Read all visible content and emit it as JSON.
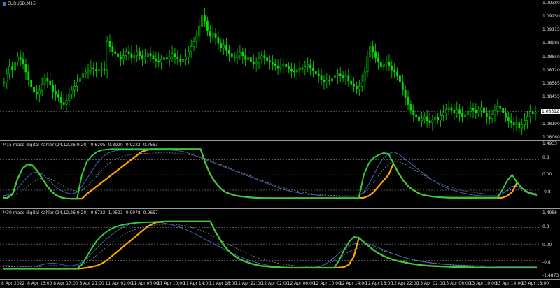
{
  "main_chart": {
    "symbol_label": "EURUSD,M15",
    "price_labels": [
      "1.09380",
      "1.09250",
      "1.09115",
      "1.08985",
      "1.08850",
      "1.08720",
      "1.08585",
      "1.08455",
      "1.08190",
      "1.08060"
    ],
    "current_price": "1.08312",
    "candle_color": "#00e000",
    "price_ylim": [
      1.0806,
      1.0938
    ],
    "closes": [
      1.086,
      1.0868,
      1.0875,
      1.0872,
      1.088,
      1.0885,
      1.0882,
      1.0878,
      1.087,
      1.0862,
      1.0855,
      1.085,
      1.0848,
      1.0852,
      1.0858,
      1.0864,
      1.0861,
      1.0857,
      1.0851,
      1.0848,
      1.0845,
      1.084,
      1.0838,
      1.0842,
      1.0848,
      1.0852,
      1.0856,
      1.086,
      1.0864,
      1.0868,
      1.087,
      1.0872,
      1.0874,
      1.0873,
      1.0871,
      1.0872,
      1.0873,
      1.0872,
      1.09,
      1.0895,
      1.089,
      1.0888,
      1.0885,
      1.0883,
      1.0886,
      1.089,
      1.0888,
      1.0884,
      1.0886,
      1.089,
      1.0886,
      1.0883,
      1.0885,
      1.0888,
      1.0886,
      1.0883,
      1.0881,
      1.088,
      1.0882,
      1.0884,
      1.0883,
      1.0885,
      1.0888,
      1.0885,
      1.0883,
      1.088,
      1.0882,
      1.0885,
      1.089,
      1.0895,
      1.09,
      1.0905,
      1.0915,
      1.0926,
      1.092,
      1.091,
      1.0905,
      1.0908,
      1.0904,
      1.0898,
      1.0894,
      1.0896,
      1.0891,
      1.0888,
      1.0885,
      1.0884,
      1.0887,
      1.0889,
      1.0886,
      1.0882,
      1.0884,
      1.088,
      1.0878,
      1.0879,
      1.0883,
      1.0886,
      1.0884,
      1.0881,
      1.088,
      1.0878,
      1.0876,
      1.0874,
      1.0876,
      1.0878,
      1.0875,
      1.0873,
      1.0871,
      1.087,
      1.0872,
      1.0874,
      1.0873,
      1.0875,
      1.0877,
      1.0874,
      1.0871,
      1.0868,
      1.0866,
      1.0862,
      1.086,
      1.0862,
      1.0861,
      1.0864,
      1.0866,
      1.0868,
      1.0866,
      1.0864,
      1.0866,
      1.0861,
      1.0858,
      1.0856,
      1.0853,
      1.0856,
      1.086,
      1.087,
      1.0885,
      1.0895,
      1.089,
      1.0884,
      1.088,
      1.0875,
      1.0878,
      1.088,
      1.0876,
      1.0872,
      1.087,
      1.0866,
      1.086,
      1.0852,
      1.0845,
      1.0838,
      1.0832,
      1.0828,
      1.0826,
      1.0822,
      1.0824,
      1.0826,
      1.0822,
      1.082,
      1.0823,
      1.0825,
      1.0823,
      1.0827,
      1.083,
      1.0833,
      1.0835,
      1.0832,
      1.083,
      1.0833,
      1.0829,
      1.0826,
      1.0828,
      1.0831,
      1.0834,
      1.0832,
      1.083,
      1.0832,
      1.0835,
      1.083,
      1.0826,
      1.0824,
      1.0828,
      1.0832,
      1.0836,
      1.0834,
      1.083,
      1.0825,
      1.0822,
      1.082,
      1.0818,
      1.082,
      1.0815,
      1.0818,
      1.0822,
      1.0826,
      1.0831,
      1.0829,
      1.0831
    ]
  },
  "indicator1": {
    "label": "M15 macd digital Kahler (14,12,26,9,20) -0.6205 -0.8920 -0.9222 -0.7563",
    "scale_labels": [
      "1.4933",
      "0.8",
      "0.00",
      "-0.8"
    ],
    "series": {
      "green": [
        -1.22,
        -1.2,
        -1.0,
        -0.2,
        0.35,
        0.55,
        0.5,
        0.2,
        -0.2,
        -0.6,
        -0.9,
        -1.1,
        -1.2,
        -1.24,
        -1.25,
        -1.25,
        0.0,
        0.7,
        1.0,
        1.2,
        1.3,
        1.33,
        1.35,
        1.35,
        1.35,
        1.35,
        1.35,
        1.35,
        1.35,
        1.35,
        1.35,
        1.35,
        1.35,
        1.35,
        1.35,
        1.35,
        1.35,
        1.35,
        1.35,
        1.35,
        1.35,
        0.6,
        0.0,
        -0.4,
        -0.7,
        -0.9,
        -1.0,
        -1.08,
        -1.12,
        -1.15,
        -1.18,
        -1.2,
        -1.21,
        -1.22,
        -1.22,
        -1.22,
        -1.22,
        -1.22,
        -1.22,
        -1.22,
        -1.22,
        -1.22,
        -1.22,
        -1.22,
        -1.22,
        -1.22,
        -1.22,
        -1.22,
        -1.22,
        -1.22,
        -1.22,
        -1.22,
        -1.22,
        0.0,
        0.6,
        0.9,
        1.05,
        1.15,
        1.1,
        0.6,
        0.1,
        -0.3,
        -0.6,
        -0.8,
        -0.95,
        -1.05,
        -1.1,
        -1.14,
        -1.16,
        -1.18,
        -1.19,
        -1.2,
        -1.2,
        -1.2,
        -1.2,
        -1.2,
        -1.2,
        -1.2,
        -1.2,
        -1.2,
        -1.2,
        -0.8,
        -0.3,
        0.0,
        -0.4,
        -0.7,
        -0.9,
        -1.0,
        -1.05
      ],
      "orange": [
        -1.22,
        -1.2,
        -1.0,
        -0.2,
        0.35,
        0.55,
        0.5,
        0.2,
        -0.2,
        -0.6,
        -0.9,
        -1.1,
        -1.2,
        -1.24,
        -1.25,
        -1.25,
        -1.25,
        -1.0,
        -0.8,
        -0.6,
        -0.4,
        -0.2,
        0.0,
        0.2,
        0.4,
        0.6,
        0.8,
        1.0,
        1.2,
        1.3,
        1.35,
        1.35,
        1.35,
        1.35,
        1.35,
        1.35,
        1.35,
        1.35,
        1.35,
        1.35,
        1.35,
        0.6,
        0.0,
        -0.4,
        -0.7,
        -0.9,
        -1.0,
        -1.08,
        -1.12,
        -1.15,
        -1.18,
        -1.2,
        -1.21,
        -1.22,
        -1.22,
        -1.22,
        -1.22,
        -1.22,
        -1.22,
        -1.22,
        -1.22,
        -1.22,
        -1.22,
        -1.22,
        -1.22,
        -1.22,
        -1.22,
        -1.22,
        -1.22,
        -1.22,
        -1.22,
        -1.22,
        -1.22,
        -1.2,
        -1.1,
        -0.9,
        -0.6,
        -0.3,
        0.0,
        0.6,
        0.1,
        -0.3,
        -0.6,
        -0.8,
        -0.95,
        -1.05,
        -1.1,
        -1.14,
        -1.16,
        -1.18,
        -1.19,
        -1.2,
        -1.2,
        -1.2,
        -1.2,
        -1.2,
        -1.2,
        -1.2,
        -1.2,
        -1.2,
        -1.2,
        -1.2,
        -1.1,
        -0.9,
        -0.4,
        -0.7,
        -0.9,
        -1.0,
        -1.05
      ],
      "blue": [
        -1.1,
        -1.05,
        -0.95,
        -0.7,
        -0.4,
        -0.1,
        0.1,
        0.15,
        0.05,
        -0.2,
        -0.45,
        -0.7,
        -0.85,
        -0.95,
        -1.0,
        -0.9,
        -0.6,
        -0.2,
        0.2,
        0.6,
        0.9,
        1.1,
        1.22,
        1.28,
        1.3,
        1.3,
        1.3,
        1.3,
        1.3,
        1.3,
        1.3,
        1.3,
        1.3,
        1.3,
        1.3,
        1.28,
        1.25,
        1.2,
        1.1,
        1.0,
        0.9,
        0.8,
        0.7,
        0.6,
        0.5,
        0.4,
        0.3,
        0.2,
        0.1,
        0.0,
        -0.1,
        -0.2,
        -0.3,
        -0.4,
        -0.5,
        -0.6,
        -0.7,
        -0.78,
        -0.85,
        -0.9,
        -0.95,
        -1.0,
        -1.02,
        -1.05,
        -1.08,
        -1.1,
        -1.12,
        -1.12,
        -1.13,
        -1.13,
        -1.13,
        -1.13,
        -1.1,
        -0.9,
        -0.5,
        0.0,
        0.5,
        0.9,
        1.1,
        1.2,
        1.1,
        0.9,
        0.7,
        0.5,
        0.3,
        0.1,
        -0.1,
        -0.3,
        -0.45,
        -0.6,
        -0.7,
        -0.8,
        -0.88,
        -0.95,
        -1.0,
        -1.05,
        -1.08,
        -1.1,
        -1.1,
        -1.1,
        -1.1,
        -1.0,
        -0.8,
        -0.6,
        -0.6,
        -0.75,
        -0.85,
        -0.95,
        -1.0
      ],
      "dotted": [
        -1.15,
        -1.1,
        -1.05,
        -0.95,
        -0.8,
        -0.6,
        -0.4,
        -0.25,
        -0.15,
        -0.15,
        -0.25,
        -0.4,
        -0.55,
        -0.7,
        -0.8,
        -0.85,
        -0.8,
        -0.6,
        -0.35,
        -0.05,
        0.25,
        0.5,
        0.7,
        0.85,
        0.95,
        1.02,
        1.08,
        1.1,
        1.12,
        1.13,
        1.14,
        1.15,
        1.15,
        1.15,
        1.15,
        1.14,
        1.12,
        1.1,
        1.05,
        1.0,
        0.95,
        0.85,
        0.75,
        0.65,
        0.55,
        0.45,
        0.35,
        0.25,
        0.15,
        0.05,
        -0.05,
        -0.15,
        -0.25,
        -0.35,
        -0.45,
        -0.55,
        -0.62,
        -0.7,
        -0.76,
        -0.82,
        -0.88,
        -0.93,
        -0.97,
        -1.0,
        -1.03,
        -1.05,
        -1.07,
        -1.08,
        -1.09,
        -1.1,
        -1.1,
        -1.1,
        -1.08,
        -0.95,
        -0.7,
        -0.4,
        -0.05,
        0.3,
        0.55,
        0.7,
        0.7,
        0.6,
        0.45,
        0.3,
        0.15,
        0.0,
        -0.15,
        -0.28,
        -0.4,
        -0.5,
        -0.6,
        -0.68,
        -0.75,
        -0.82,
        -0.87,
        -0.92,
        -0.95,
        -0.98,
        -1.0,
        -1.0,
        -1.0,
        -0.95,
        -0.85,
        -0.75,
        -0.75,
        -0.82,
        -0.88,
        -0.93,
        -0.97
      ]
    }
  },
  "indicator2": {
    "label": "M30 macd digital Kahler (14,12,26,9,20) -0.8722 -1.0593 -0.9978 -0.9657",
    "scale_labels": [
      "1.4956",
      "0.8",
      "0.00",
      "-0.8",
      "-1.4873"
    ],
    "series": {
      "green": [
        -1.2,
        -1.2,
        -1.2,
        -1.2,
        -1.2,
        -1.2,
        -1.2,
        -1.2,
        -1.2,
        -1.2,
        -1.2,
        -1.2,
        -1.2,
        -1.2,
        -1.2,
        -1.2,
        -1.0,
        -0.6,
        -0.2,
        0.15,
        0.4,
        0.6,
        0.75,
        0.85,
        0.92,
        0.97,
        1.0,
        1.03,
        1.05,
        1.06,
        1.07,
        1.08,
        1.09,
        1.1,
        1.1,
        1.1,
        1.1,
        1.1,
        1.1,
        1.1,
        1.1,
        1.1,
        1.1,
        0.6,
        0.2,
        -0.15,
        -0.4,
        -0.6,
        -0.75,
        -0.85,
        -0.93,
        -1.0,
        -1.05,
        -1.08,
        -1.1,
        -1.12,
        -1.13,
        -1.14,
        -1.15,
        -1.15,
        -1.15,
        -1.15,
        -1.15,
        -1.15,
        -1.15,
        -1.15,
        -1.15,
        -1.15,
        -0.8,
        -0.3,
        0.1,
        0.35,
        0.3,
        0.1,
        -0.1,
        -0.3,
        -0.45,
        -0.58,
        -0.68,
        -0.76,
        -0.83,
        -0.88,
        -0.93,
        -0.97,
        -1.0,
        -1.03,
        -1.05,
        -1.07,
        -1.08,
        -1.09,
        -1.1,
        -1.11,
        -1.12,
        -1.12,
        -1.13,
        -1.13,
        -1.14,
        -1.14,
        -1.15,
        -1.15,
        -1.15,
        -1.15,
        -1.15,
        -1.15,
        -1.15,
        -1.15,
        -1.15,
        -1.15,
        -1.15
      ],
      "orange": [
        -1.2,
        -1.2,
        -1.2,
        -1.2,
        -1.2,
        -1.2,
        -1.2,
        -1.2,
        -1.2,
        -1.2,
        -1.2,
        -1.2,
        -1.2,
        -1.2,
        -1.2,
        -1.2,
        -1.18,
        -1.15,
        -1.1,
        -1.05,
        -0.95,
        -0.8,
        -0.6,
        -0.4,
        -0.2,
        0.0,
        0.2,
        0.4,
        0.6,
        0.8,
        0.95,
        1.05,
        1.08,
        1.1,
        1.1,
        1.1,
        1.1,
        1.1,
        1.1,
        1.1,
        1.1,
        1.1,
        1.1,
        0.6,
        0.2,
        -0.15,
        -0.4,
        -0.6,
        -0.75,
        -0.85,
        -0.93,
        -1.0,
        -1.05,
        -1.08,
        -1.1,
        -1.12,
        -1.13,
        -1.14,
        -1.15,
        -1.15,
        -1.15,
        -1.15,
        -1.15,
        -1.15,
        -1.15,
        -1.15,
        -1.15,
        -1.15,
        -1.14,
        -1.12,
        -1.0,
        -0.6,
        0.3,
        0.1,
        -0.1,
        -0.3,
        -0.45,
        -0.58,
        -0.68,
        -0.76,
        -0.83,
        -0.88,
        -0.93,
        -0.97,
        -1.0,
        -1.03,
        -1.05,
        -1.07,
        -1.08,
        -1.09,
        -1.1,
        -1.11,
        -1.12,
        -1.12,
        -1.13,
        -1.13,
        -1.14,
        -1.14,
        -1.15,
        -1.15,
        -1.15,
        -1.15,
        -1.15,
        -1.15,
        -1.15,
        -1.15,
        -1.15,
        -1.15,
        -1.15
      ],
      "blue": [
        -1.05,
        -1.05,
        -1.06,
        -1.07,
        -1.08,
        -1.08,
        -1.08,
        -1.06,
        -1.0,
        -0.95,
        -0.92,
        -0.95,
        -1.0,
        -1.05,
        -1.05,
        -1.0,
        -0.9,
        -0.7,
        -0.45,
        -0.2,
        0.05,
        0.25,
        0.45,
        0.62,
        0.78,
        0.9,
        0.98,
        1.03,
        1.06,
        1.07,
        1.07,
        1.06,
        1.04,
        1.0,
        0.95,
        0.88,
        0.8,
        0.7,
        0.6,
        0.48,
        0.35,
        0.22,
        0.1,
        -0.02,
        -0.15,
        -0.28,
        -0.4,
        -0.52,
        -0.62,
        -0.72,
        -0.8,
        -0.88,
        -0.95,
        -1.0,
        -1.05,
        -1.08,
        -1.11,
        -1.13,
        -1.15,
        -1.16,
        -1.17,
        -1.17,
        -1.17,
        -1.15,
        -1.1,
        -1.0,
        -0.85,
        -0.65,
        -0.45,
        -0.25,
        -0.1,
        0.0,
        0.05,
        0.05,
        0.0,
        -0.08,
        -0.18,
        -0.28,
        -0.38,
        -0.48,
        -0.56,
        -0.64,
        -0.7,
        -0.76,
        -0.82,
        -0.86,
        -0.9,
        -0.93,
        -0.96,
        -0.98,
        -1.0,
        -1.02,
        -1.03,
        -1.04,
        -1.05,
        -1.06,
        -1.07,
        -1.08,
        -1.08,
        -1.08,
        -1.09,
        -1.09,
        -1.09,
        -1.09,
        -1.09,
        -1.09,
        -1.09,
        -1.09,
        -1.09
      ],
      "dotted": [
        -1.1,
        -1.1,
        -1.1,
        -1.1,
        -1.1,
        -1.1,
        -1.1,
        -1.1,
        -1.08,
        -1.06,
        -1.04,
        -1.04,
        -1.06,
        -1.08,
        -1.08,
        -1.06,
        -1.0,
        -0.88,
        -0.72,
        -0.55,
        -0.35,
        -0.15,
        0.05,
        0.22,
        0.38,
        0.52,
        0.64,
        0.73,
        0.8,
        0.86,
        0.9,
        0.93,
        0.95,
        0.96,
        0.96,
        0.95,
        0.92,
        0.88,
        0.82,
        0.75,
        0.66,
        0.56,
        0.45,
        0.33,
        0.2,
        0.07,
        -0.06,
        -0.18,
        -0.3,
        -0.41,
        -0.52,
        -0.61,
        -0.7,
        -0.77,
        -0.84,
        -0.9,
        -0.95,
        -0.99,
        -1.02,
        -1.05,
        -1.07,
        -1.08,
        -1.09,
        -1.09,
        -1.07,
        -1.02,
        -0.94,
        -0.82,
        -0.68,
        -0.52,
        -0.38,
        -0.26,
        -0.18,
        -0.14,
        -0.14,
        -0.18,
        -0.25,
        -0.33,
        -0.41,
        -0.49,
        -0.57,
        -0.64,
        -0.7,
        -0.75,
        -0.8,
        -0.85,
        -0.88,
        -0.91,
        -0.94,
        -0.96,
        -0.98,
        -1.0,
        -1.01,
        -1.02,
        -1.03,
        -1.04,
        -1.05,
        -1.05,
        -1.06,
        -1.06,
        -1.06,
        -1.07,
        -1.07,
        -1.07,
        -1.07,
        -1.07,
        -1.07,
        -1.07,
        -1.07
      ]
    }
  },
  "colors": {
    "green": "#2ecc40",
    "orange": "#ffa500",
    "blue": "#3f6fc4",
    "dotted": "#9a9a9a",
    "level_line": "#8a8a8a",
    "price_line": "#6f6f6f"
  },
  "time_axis": [
    "8 Apr 2022",
    "8 Apr 13:00",
    "8 Apr 17:00",
    "8 Apr 21:00",
    "11 Apr 02:00",
    "11 Apr 06:00",
    "11 Apr 10:00",
    "11 Apr 14:00",
    "11 Apr 18:00",
    "11 Apr 22:00",
    "12 Apr 02:00",
    "12 Apr 06:00",
    "12 Apr 10:00",
    "12 Apr 14:00",
    "12 Apr 18:00",
    "12 Apr 22:00",
    "13 Apr 02:00",
    "13 Apr 06:00",
    "13 Apr 10:00",
    "13 Apr 14:00",
    "13 Apr 18:00"
  ]
}
